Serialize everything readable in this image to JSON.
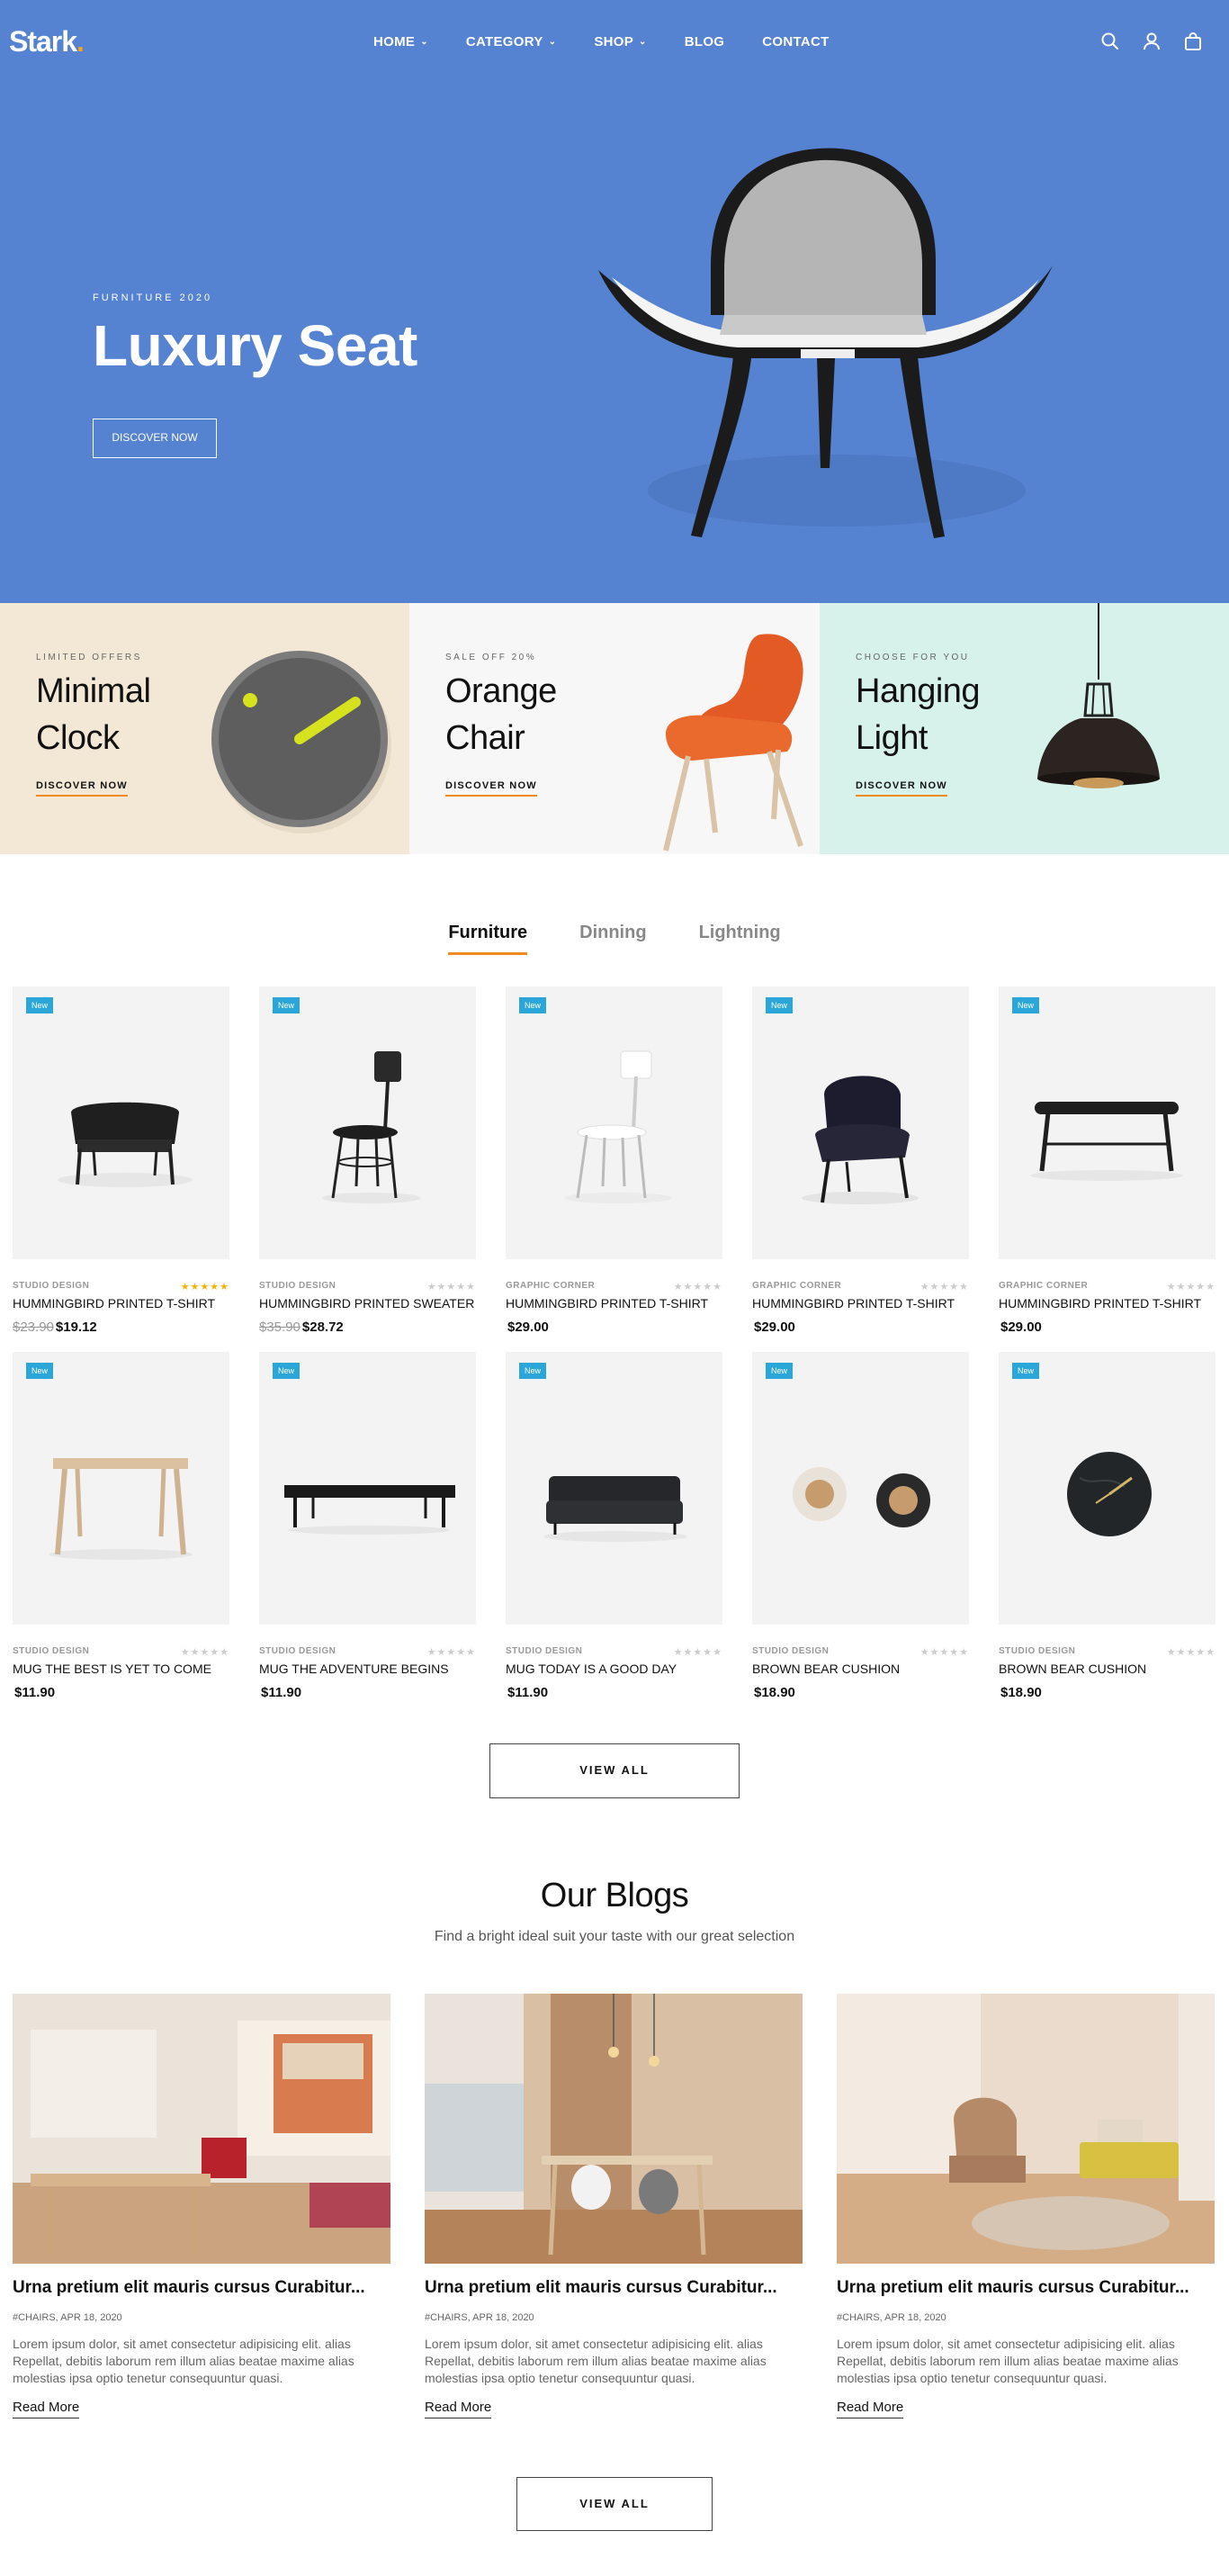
{
  "header": {
    "logo_text": "Stark",
    "logo_dot": ".",
    "logo_dot_color": "#f4a21a",
    "nav": [
      {
        "label": "HOME",
        "has_dropdown": true
      },
      {
        "label": "CATEGORY",
        "has_dropdown": true
      },
      {
        "label": "SHOP",
        "has_dropdown": true
      },
      {
        "label": "BLOG",
        "has_dropdown": false
      },
      {
        "label": "CONTACT",
        "has_dropdown": false
      }
    ],
    "icons": [
      "search-icon",
      "user-icon",
      "cart-icon"
    ]
  },
  "hero": {
    "eyebrow": "FURNITURE 2020",
    "title": "Luxury Seat",
    "button": "DISCOVER NOW",
    "bg_color": "#5582d1"
  },
  "promos": [
    {
      "eyebrow": "LIMITED OFFERS",
      "title": "Minimal Clock",
      "link": "DISCOVER NOW",
      "bg_color": "#f2e8d5"
    },
    {
      "eyebrow": "SALE OFF 20%",
      "title": "Orange Chair",
      "link": "DISCOVER NOW",
      "bg_color": "#f7f7f7"
    },
    {
      "eyebrow": "CHOOSE FOR YOU",
      "title": "Hanging Light",
      "link": "DISCOVER NOW",
      "bg_color": "#d6f2ea"
    }
  ],
  "tabs": [
    {
      "label": "Furniture",
      "active": true
    },
    {
      "label": "Dinning",
      "active": false
    },
    {
      "label": "Lightning",
      "active": false
    }
  ],
  "products": [
    {
      "badge": "New",
      "brand": "STUDIO DESIGN",
      "stars": "★★★★★",
      "rated": true,
      "name": "HUMMINGBIRD PRINTED T-SHIRT",
      "old_price": "$23.90",
      "price": "$19.12",
      "image": "black-armchair"
    },
    {
      "badge": "New",
      "brand": "STUDIO DESIGN",
      "stars": "★★★★★",
      "rated": false,
      "name": "HUMMINGBIRD PRINTED SWEATER",
      "old_price": "$35.90",
      "price": "$28.72",
      "image": "black-bar-chair"
    },
    {
      "badge": "New",
      "brand": "GRAPHIC CORNER",
      "stars": "★★★★★",
      "rated": false,
      "name": "HUMMINGBIRD PRINTED T-SHIRT",
      "old_price": "",
      "price": "$29.00",
      "image": "white-chair"
    },
    {
      "badge": "New",
      "brand": "GRAPHIC CORNER",
      "stars": "★★★★★",
      "rated": false,
      "name": "HUMMINGBIRD PRINTED T-SHIRT",
      "old_price": "",
      "price": "$29.00",
      "image": "navy-lounge-chair"
    },
    {
      "badge": "New",
      "brand": "GRAPHIC CORNER",
      "stars": "★★★★★",
      "rated": false,
      "name": "HUMMINGBIRD PRINTED T-SHIRT",
      "old_price": "",
      "price": "$29.00",
      "image": "black-bench"
    },
    {
      "badge": "New",
      "brand": "STUDIO DESIGN",
      "stars": "★★★★★",
      "rated": false,
      "name": "MUG THE BEST IS YET TO COME",
      "old_price": "",
      "price": "$11.90",
      "image": "wood-table"
    },
    {
      "badge": "New",
      "brand": "STUDIO DESIGN",
      "stars": "★★★★★",
      "rated": false,
      "name": "MUG THE ADVENTURE BEGINS",
      "old_price": "",
      "price": "$11.90",
      "image": "leather-bench"
    },
    {
      "badge": "New",
      "brand": "STUDIO DESIGN",
      "stars": "★★★★★",
      "rated": false,
      "name": "MUG TODAY IS A GOOD DAY",
      "old_price": "",
      "price": "$11.90",
      "image": "sofa"
    },
    {
      "badge": "New",
      "brand": "STUDIO DESIGN",
      "stars": "★★★★★",
      "rated": false,
      "name": "BROWN BEAR CUSHION",
      "old_price": "",
      "price": "$18.90",
      "image": "cork-jars"
    },
    {
      "badge": "New",
      "brand": "STUDIO DESIGN",
      "stars": "★★★★★",
      "rated": false,
      "name": "BROWN BEAR CUSHION",
      "old_price": "",
      "price": "$18.90",
      "image": "marble-clock"
    }
  ],
  "products_view_all": "VIEW ALL",
  "blogs": {
    "title": "Our Blogs",
    "subtitle": "Find a bright ideal suit your taste with our great selection",
    "posts": [
      {
        "title": "Urna pretium elit mauris cursus Curabitur...",
        "meta": "#CHAIRS, APR 18, 2020",
        "excerpt": "Lorem ipsum dolor, sit amet consectetur adipisicing elit. alias Repellat, debitis laborum rem illum alias beatae maxime alias molestias ipsa optio tenetur consequuntur quasi.",
        "read_more": "Read More"
      },
      {
        "title": "Urna pretium elit mauris cursus Curabitur...",
        "meta": "#CHAIRS, APR 18, 2020",
        "excerpt": "Lorem ipsum dolor, sit amet consectetur adipisicing elit. alias Repellat, debitis laborum rem illum alias beatae maxime alias molestias ipsa optio tenetur consequuntur quasi.",
        "read_more": "Read More"
      },
      {
        "title": "Urna pretium elit mauris cursus Curabitur...",
        "meta": "#CHAIRS, APR 18, 2020",
        "excerpt": "Lorem ipsum dolor, sit amet consectetur adipisicing elit. alias Repellat, debitis laborum rem illum alias beatae maxime alias molestias ipsa optio tenetur consequuntur quasi.",
        "read_more": "Read More"
      }
    ],
    "view_all": "VIEW ALL"
  }
}
